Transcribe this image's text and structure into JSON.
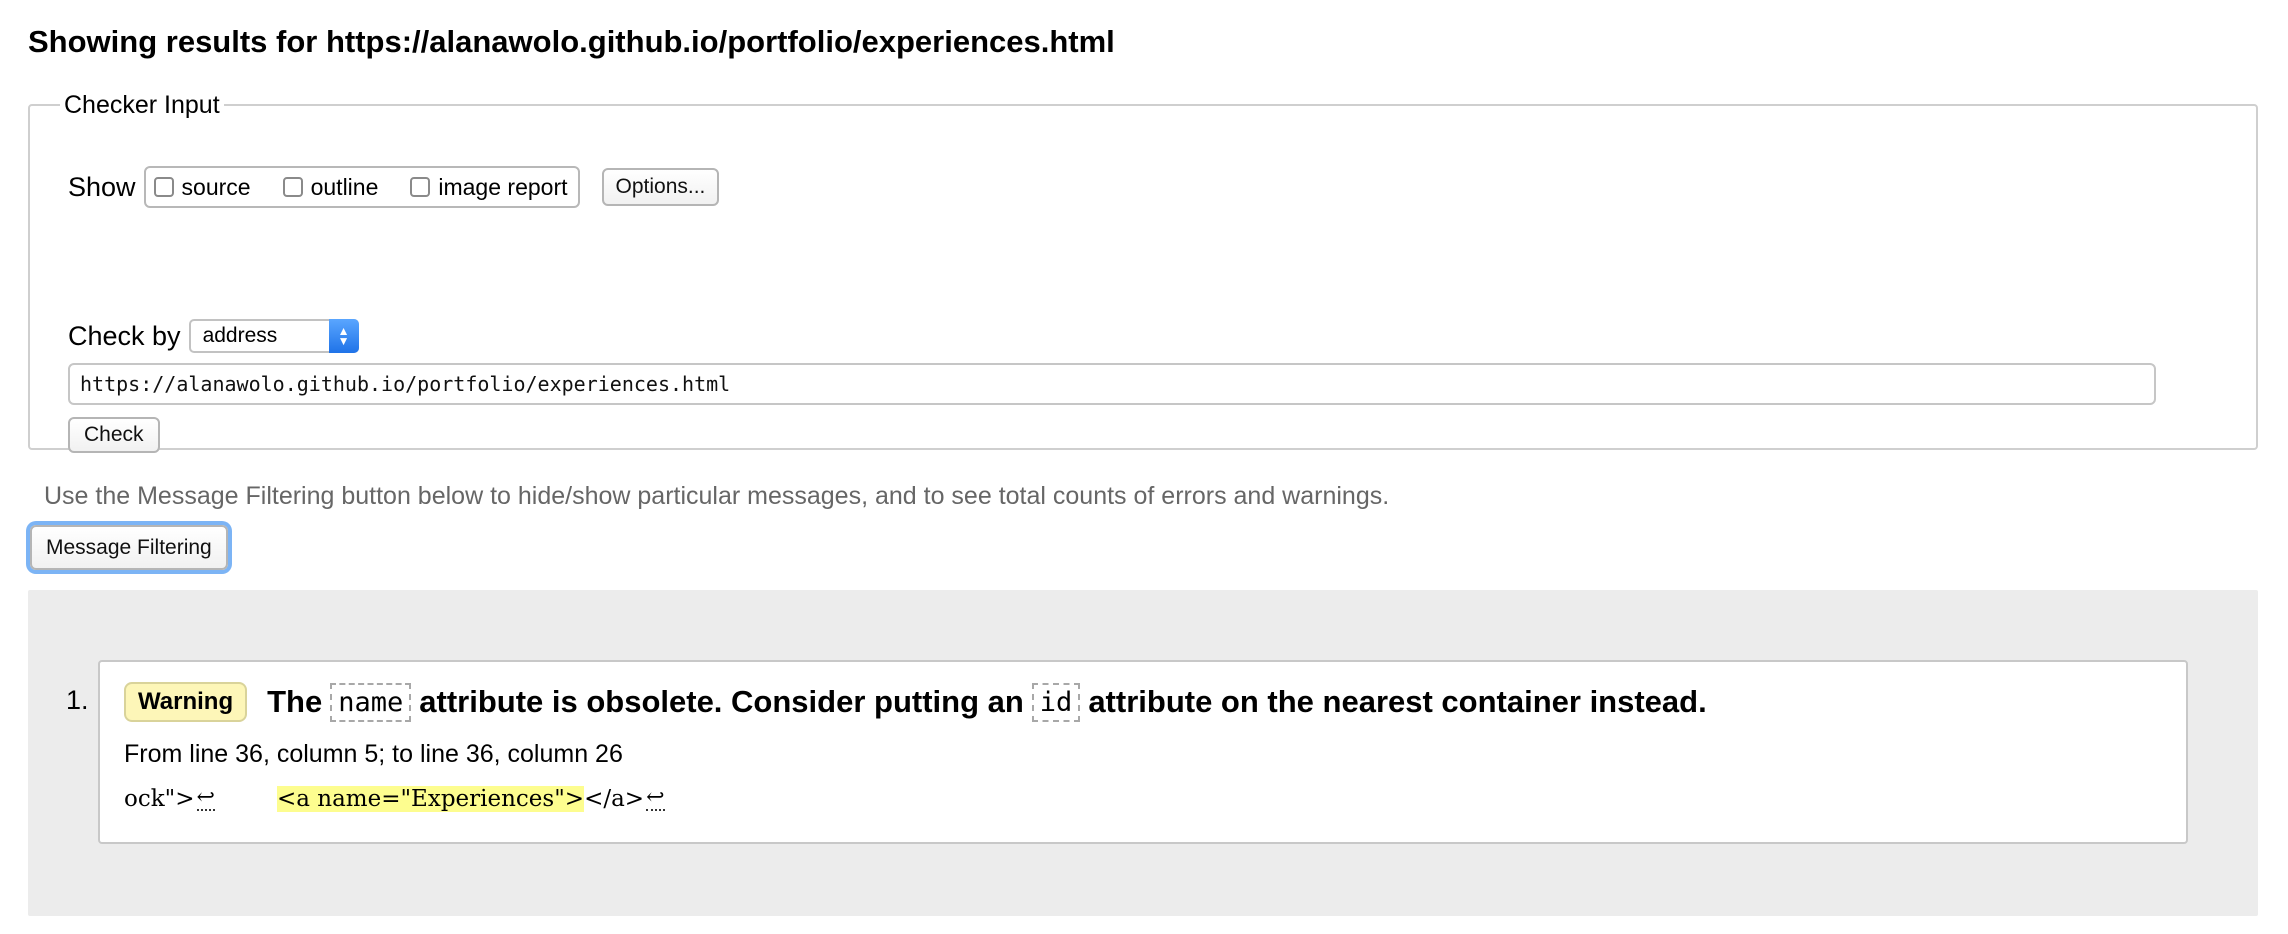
{
  "heading": "Showing results for https://alanawolo.github.io/portfolio/experiences.html",
  "checker": {
    "legend": "Checker Input",
    "show_label": "Show",
    "checkboxes": [
      {
        "label": "source",
        "checked": false
      },
      {
        "label": "outline",
        "checked": false
      },
      {
        "label": "image report",
        "checked": false
      }
    ],
    "options_label": "Options...",
    "check_by_label": "Check by",
    "check_by_value": "address",
    "url_value": "https://alanawolo.github.io/portfolio/experiences.html",
    "check_label": "Check"
  },
  "filter_note": "Use the Message Filtering button below to hide/show particular messages, and to see total counts of errors and warnings.",
  "filter_button_label": "Message Filtering",
  "messages": [
    {
      "number": "1.",
      "type": "Warning",
      "text_1": "The",
      "code_1": "name",
      "text_2": "attribute is obsolete. Consider putting an",
      "code_2": "id",
      "text_3": "attribute on the nearest container instead.",
      "location": "From line 36, column 5; to line 36, column 26",
      "extract_before": "ock\">",
      "extract_highlight": "<a name=\"Experiences\">",
      "extract_after": "</a>",
      "return_glyph": "↩"
    }
  ],
  "colors": {
    "badge_bg": "#fdf6b8",
    "highlight": "#fdfd8f",
    "messages_bg": "#ececec",
    "focus_ring": "#7cb4f5"
  }
}
